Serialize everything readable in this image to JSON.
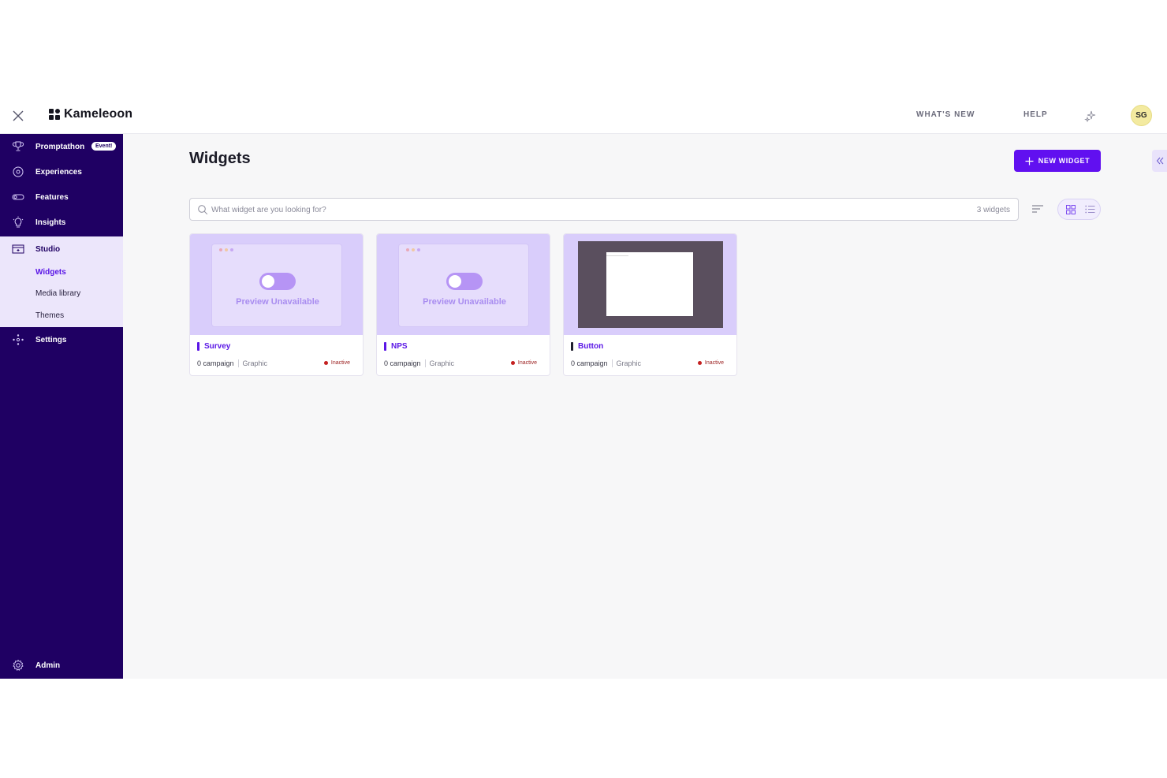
{
  "topbar": {
    "brand": "Kameleoon",
    "whats_new": "WHAT'S NEW",
    "help": "HELP",
    "avatar_initials": "SG"
  },
  "sidebar": {
    "items": [
      {
        "label": "Promptathon",
        "badge": "Event!",
        "icon": "trophy-icon"
      },
      {
        "label": "Experiences",
        "icon": "target-icon"
      },
      {
        "label": "Features",
        "icon": "toggle-icon"
      },
      {
        "label": "Insights",
        "icon": "lightbulb-icon"
      },
      {
        "label": "Studio",
        "icon": "studio-icon"
      },
      {
        "label": "Settings",
        "icon": "nodes-icon"
      },
      {
        "label": "Admin",
        "icon": "gear-icon"
      }
    ],
    "studio_sub": [
      {
        "label": "Widgets",
        "active": true
      },
      {
        "label": "Media library",
        "active": false
      },
      {
        "label": "Themes",
        "active": false
      }
    ]
  },
  "main": {
    "title": "Widgets",
    "new_button": "NEW WIDGET",
    "search_placeholder": "What widget are you looking for?",
    "widget_count": "3 widgets",
    "view_mode": "grid"
  },
  "widgets": [
    {
      "name": "Survey",
      "campaigns": "0 campaign",
      "type": "Graphic",
      "status": "Inactive",
      "preview": "Preview Unavailable"
    },
    {
      "name": "NPS",
      "campaigns": "0 campaign",
      "type": "Graphic",
      "status": "Inactive",
      "preview": "Preview Unavailable"
    },
    {
      "name": "Button",
      "campaigns": "0 campaign",
      "type": "Graphic",
      "status": "Inactive",
      "preview": ""
    }
  ],
  "colors": {
    "sidebar_bg": "#1f0063",
    "accent": "#6110f0",
    "studio_bg": "#ece6fb",
    "inactive": "#c42020"
  }
}
